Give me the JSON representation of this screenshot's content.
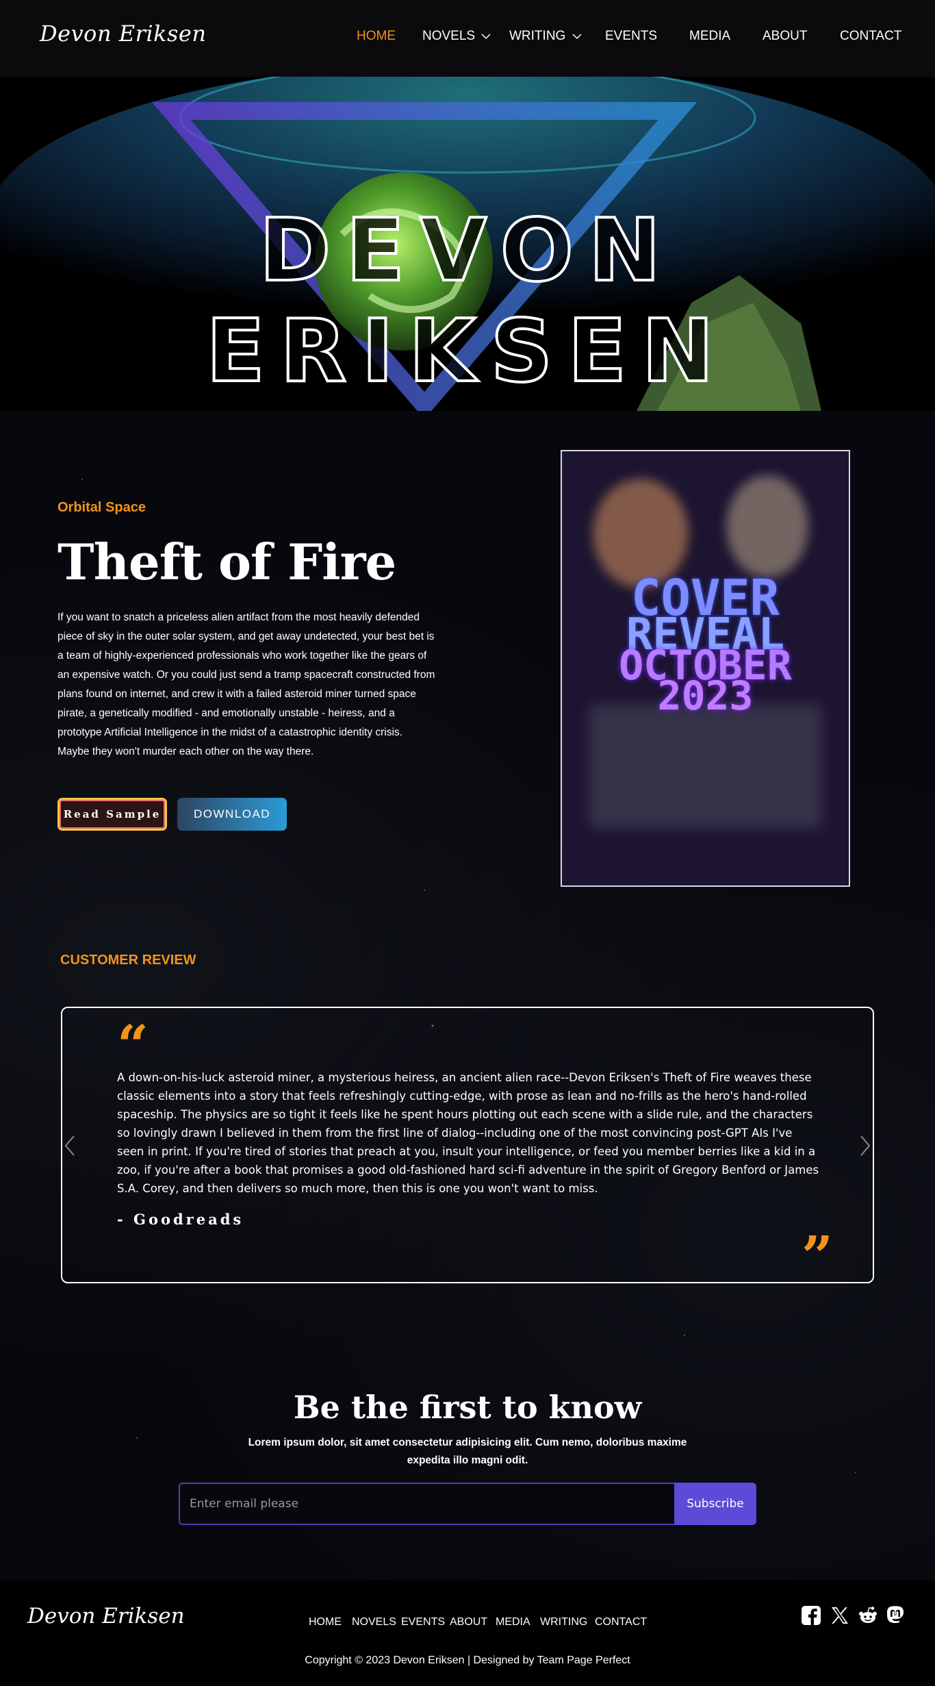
{
  "header": {
    "logo": "Devon Eriksen",
    "nav": [
      {
        "label": "HOME",
        "active": true,
        "dropdown": false
      },
      {
        "label": "NOVELS",
        "active": false,
        "dropdown": true
      },
      {
        "label": "WRITING",
        "active": false,
        "dropdown": true
      },
      {
        "label": "EVENTS",
        "active": false,
        "dropdown": false
      },
      {
        "label": "MEDIA",
        "active": false,
        "dropdown": false
      },
      {
        "label": "ABOUT",
        "active": false,
        "dropdown": false
      },
      {
        "label": "CONTACT",
        "active": false,
        "dropdown": false
      }
    ]
  },
  "hero": {
    "title": "DEVON ERIKSEN"
  },
  "feature": {
    "series": "Orbital Space",
    "title": "Theft of Fire",
    "synopsis": "If you want to snatch a priceless alien artifact from the most heavily defended piece of sky in the outer solar system, and get away undetected, your best bet is a team of highly-experienced professionals who work together like the gears of an expensive watch. Or you could just send a tramp spacecraft constructed from plans found on internet, and crew it with a failed asteroid miner turned space pirate, a genetically modified - and emotionally unstable - heiress, and a prototype Artificial Intelligence in the midst of a catastrophic identity crisis. Maybe they won't murder each other on the way there.",
    "read_sample_label": "Read Sample",
    "download_label": "DOWNLOAD",
    "cover": {
      "line1": "COVER",
      "line2": "REVEAL",
      "line3": "OCTOBER",
      "line4": "2023"
    }
  },
  "reviews": {
    "section_label": "CUSTOMER REVIEW",
    "items": [
      {
        "text": "A down-on-his-luck asteroid miner, a mysterious heiress, an ancient alien race--Devon Eriksen's Theft of Fire weaves these classic elements into a story that feels refreshingly cutting-edge, with prose as lean and no-frills as the hero's hand-rolled spaceship. The physics are so tight it feels like he spent hours plotting out each scene with a slide rule, and the characters so lovingly drawn I believed in them from the first line of dialog--including one of the most convincing post-GPT AIs I've seen in print. If you're tired of stories that preach at you, insult your intelligence, or feed you member berries like a kid in a zoo, if you're after a book that promises a good old-fashioned hard sci-fi adventure in the spirit of Gregory Benford or James S.A. Corey, and then delivers so much more, then this is one you won't want to miss.",
        "source": "- Goodreads"
      }
    ]
  },
  "newsletter": {
    "title": "Be the first to know",
    "subtitle": "Lorem ipsum dolor, sit amet consectetur adipisicing elit. Cum nemo, doloribus maxime expedita illo magni odit.",
    "placeholder": "Enter email please",
    "button_label": "Subscribe"
  },
  "footer": {
    "logo": "Devon Eriksen",
    "nav": [
      "HOME",
      "NOVELS",
      "EVENTS",
      "ABOUT",
      "MEDIA",
      "WRITING",
      "CONTACT"
    ],
    "socials": [
      "facebook-icon",
      "x-twitter-icon",
      "reddit-icon",
      "mastodon-icon"
    ],
    "copyright": "Copyright © 2023 Devon Eriksen | Designed by Team Page Perfect"
  },
  "colors": {
    "accent": "#f29418",
    "subscribe": "#5b4bd6",
    "download_gradient": [
      "#2e4560",
      "#2a9bd8"
    ]
  }
}
